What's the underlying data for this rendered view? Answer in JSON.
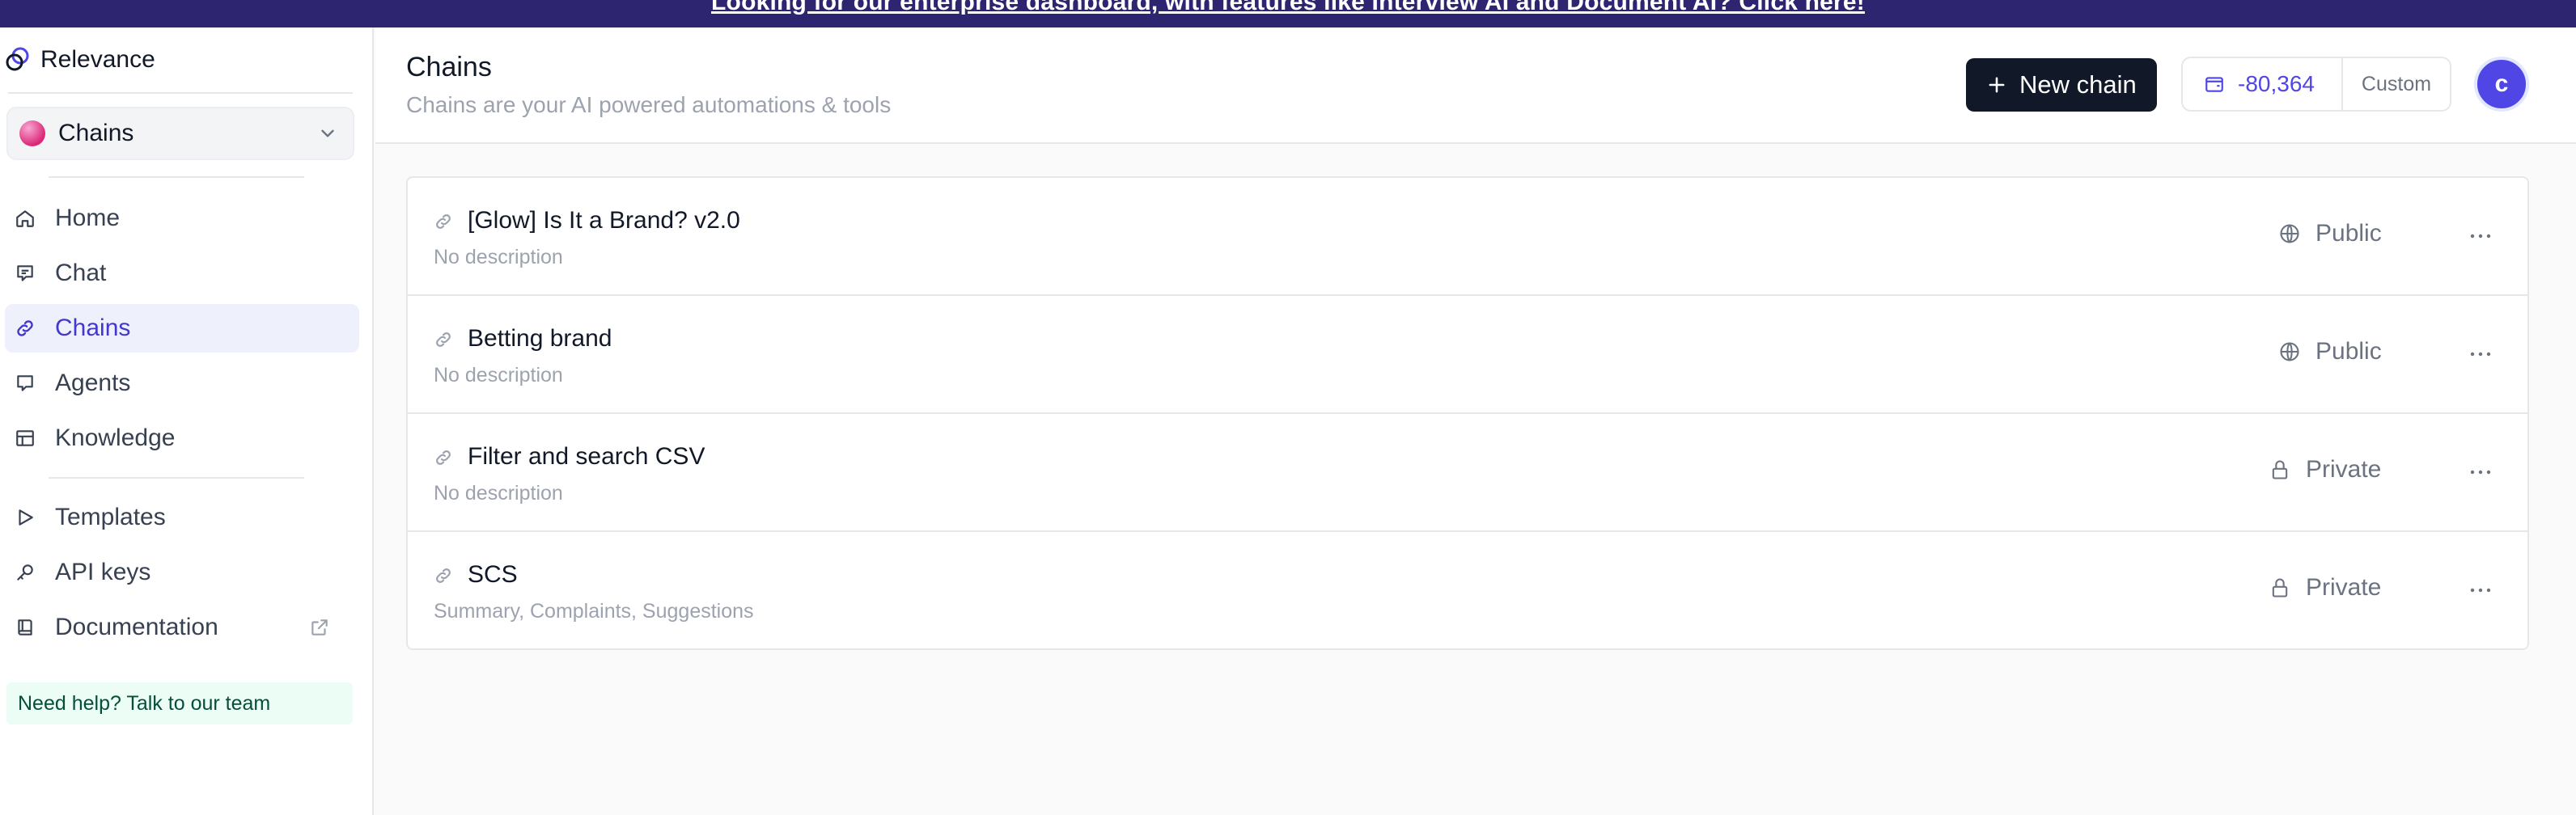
{
  "banner": {
    "text": "Looking for our enterprise dashboard, with features like Interview AI and Document AI? Click here!"
  },
  "sidebar": {
    "brand": "Relevance",
    "workspace": "Chains",
    "nav": [
      {
        "label": "Home",
        "icon": "home-icon"
      },
      {
        "label": "Chat",
        "icon": "chat-icon"
      },
      {
        "label": "Chains",
        "icon": "link-icon",
        "active": true
      },
      {
        "label": "Agents",
        "icon": "agent-icon"
      },
      {
        "label": "Knowledge",
        "icon": "table-icon"
      }
    ],
    "nav2": [
      {
        "label": "Templates",
        "icon": "play-icon"
      },
      {
        "label": "API keys",
        "icon": "key-icon"
      },
      {
        "label": "Documentation",
        "icon": "book-icon"
      }
    ],
    "help": "Need help? Talk to our team"
  },
  "header": {
    "title": "Chains",
    "subtitle": "Chains are your AI powered automations & tools",
    "new_button": "New chain",
    "credits": "-80,364",
    "plan": "Custom",
    "avatar_initial": "c"
  },
  "chains": [
    {
      "title": "[Glow] Is It a Brand? v2.0",
      "description": "No description",
      "visibility": "Public"
    },
    {
      "title": "Betting brand",
      "description": "No description",
      "visibility": "Public"
    },
    {
      "title": "Filter and search CSV",
      "description": "No description",
      "visibility": "Private"
    },
    {
      "title": "SCS",
      "description": "Summary, Complaints, Suggestions",
      "visibility": "Private"
    }
  ],
  "colors": {
    "banner": "#2e2570",
    "accent": "#4f46e5",
    "primary_button": "#111827",
    "help_bg": "#ecfdf5"
  }
}
